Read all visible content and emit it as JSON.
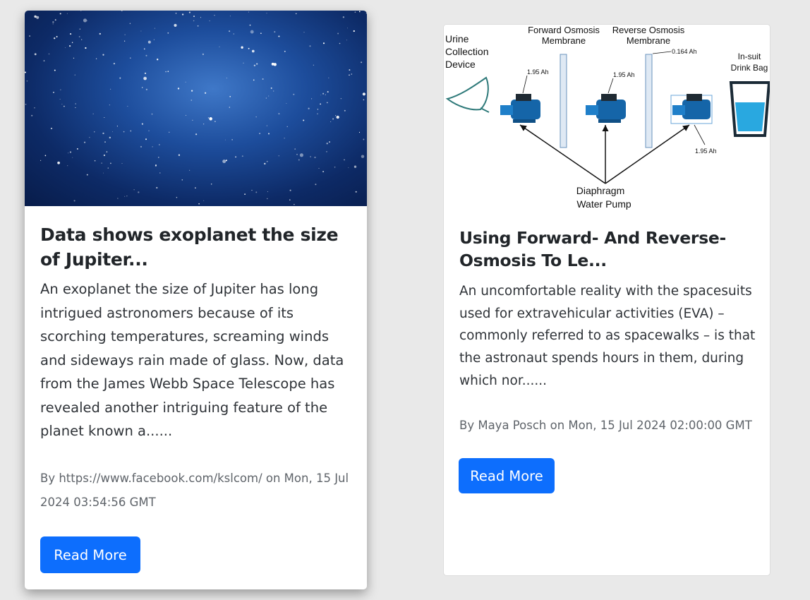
{
  "cards": [
    {
      "image_alt": "starfield-image",
      "title": "Data shows exoplanet the size of Jupiter...",
      "description": "An exoplanet the size of Jupiter has long intrigued astronomers because of its scorching temperatures, screaming winds and sideways rain made of glass. Now, data from the James Webb Space Telescope has revealed another intriguing feature of the planet known a......",
      "byline": "By https://www.facebook.com/kslcom/ on Mon, 15 Jul 2024 03:54:56 GMT",
      "button_label": "Read More"
    },
    {
      "title": "Using Forward- And Reverse-Osmosis To Le...",
      "description": "An uncomfortable reality with the spacesuits used for extravehicular activities (EVA) – commonly referred to as spacewalks – is that the astronaut spends hours in them, during which nor......",
      "byline": "By Maya Posch on Mon, 15 Jul 2024 02:00:00 GMT",
      "button_label": "Read More",
      "diagram": {
        "urine_label_1": "Urine",
        "urine_label_2": "Collection",
        "urine_label_3": "Device",
        "fo_label_1": "Forward Osmosis",
        "fo_label_2": "Membrane",
        "ro_label_1": "Reverse Osmosis",
        "ro_label_2": "Membrane",
        "drink_label_1": "In-suit",
        "drink_label_2": "Drink Bag",
        "pump_label_1": "Diaphragm",
        "pump_label_2": "Water Pump",
        "ah_1": "1.95 Ah",
        "ah_2": "1.95 Ah",
        "ah_3": "0.164 Ah",
        "ah_4": "1.95 Ah"
      }
    }
  ],
  "colors": {
    "button": "#0d6efd",
    "pump": "#1565a8",
    "page_bg": "#e9e9e9"
  }
}
